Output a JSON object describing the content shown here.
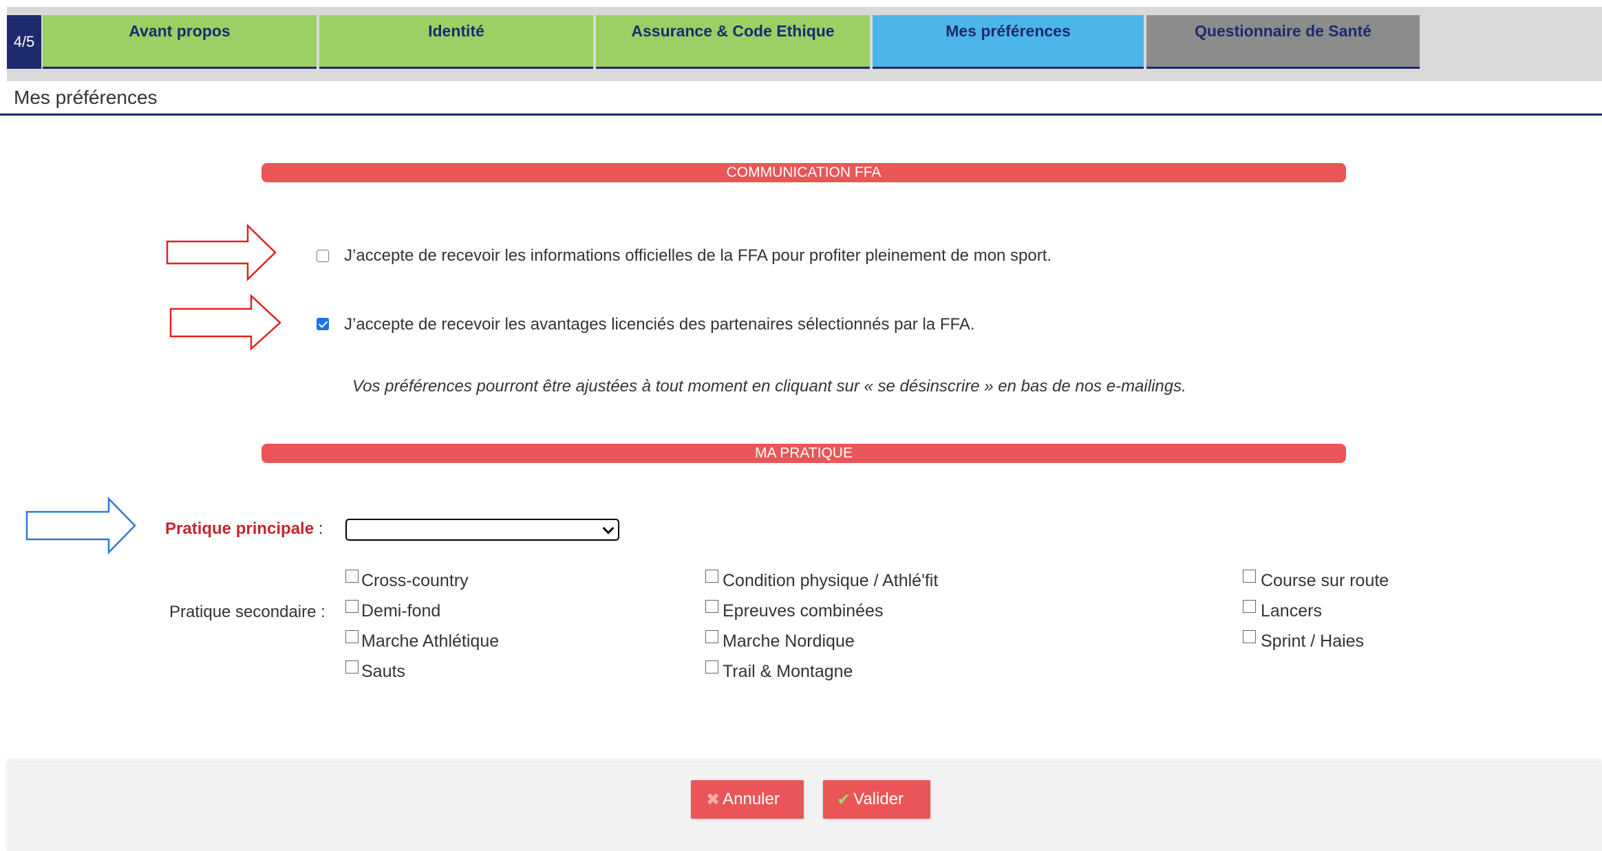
{
  "step": "4/5",
  "tabs": [
    {
      "label": "Avant propos",
      "color": "#9ccf64"
    },
    {
      "label": "Identité",
      "color": "#9ccf64"
    },
    {
      "label": "Assurance & Code Ethique",
      "color": "#9ccf64"
    },
    {
      "label": "Mes préférences",
      "color": "#4db6e8"
    },
    {
      "label": "Questionnaire de Santé",
      "color": "#8c8c8c"
    }
  ],
  "page_title": "Mes préférences",
  "communication": {
    "header": "COMMUNICATION FFA",
    "consent_official": {
      "label": "J’accepte de recevoir les informations officielles de la FFA pour profiter pleinement de mon sport.",
      "checked": false
    },
    "consent_partners": {
      "label": "J’accepte de recevoir les avantages licenciés des partenaires sélectionnés par la FFA.",
      "checked": true
    },
    "note": "Vos préférences pourront être ajustées à tout moment en cliquant sur « se désinscrire » en bas de nos e-mailings."
  },
  "pratique": {
    "header": "MA PRATIQUE",
    "main_label": "Pratique principale",
    "main_colon": " :",
    "main_value": "",
    "secondary_label": "Pratique secondaire :",
    "options": [
      "Cross-country",
      "Condition physique / Athlé'fit",
      "Course sur route",
      "Demi-fond",
      "Epreuves combinées",
      "Lancers",
      "Marche Athlétique",
      "Marche Nordique",
      "Sprint / Haies",
      "Sauts",
      "Trail & Montagne"
    ]
  },
  "buttons": {
    "cancel": "Annuler",
    "confirm": "Valider"
  },
  "colors": {
    "accent_red": "#ea5657",
    "navy": "#1d2a6e",
    "tab_green": "#9ccf64",
    "tab_blue": "#4db6e8",
    "tab_grey": "#8c8c8c",
    "annotation_red": "#e02020",
    "annotation_blue": "#2a7bd4"
  },
  "icons": {
    "cancel": "cross-icon",
    "confirm": "check-icon"
  }
}
